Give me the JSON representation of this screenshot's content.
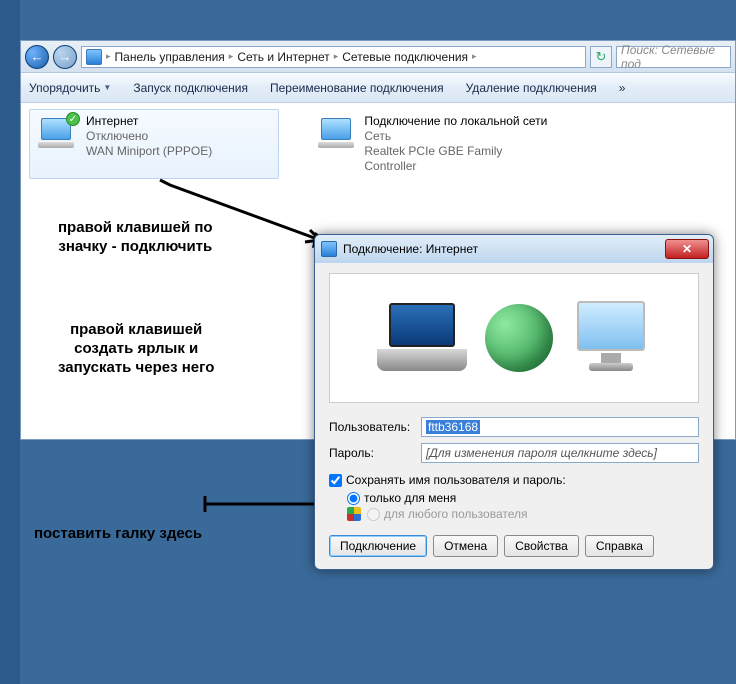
{
  "breadcrumb": {
    "l1": "Панель управления",
    "l2": "Сеть и Интернет",
    "l3": "Сетевые подключения"
  },
  "search_placeholder": "Поиск: Сетевые под",
  "toolbar": {
    "organize": "Упорядочить",
    "start": "Запуск подключения",
    "rename": "Переименование подключения",
    "delete": "Удаление подключения",
    "more": "»"
  },
  "conn1": {
    "name": "Интернет",
    "status": "Отключено",
    "device": "WAN Miniport (PPPOE)"
  },
  "conn2": {
    "name": "Подключение по локальной сети",
    "status": "Сеть",
    "device": "Realtek PCIe GBE Family Controller"
  },
  "annot1": "правой клавишей по\nзначку - подключить",
  "annot2": "правой клавишей\nсоздать ярлык и\nзапускать через него",
  "annot3": "поставить галку здесь",
  "dialog": {
    "title": "Подключение: Интернет",
    "user_label": "Пользователь:",
    "user_value": "fttb36168",
    "pass_label": "Пароль:",
    "pass_value": "[Для изменения пароля щелкните здесь]",
    "save_check": "Сохранять имя пользователя и пароль:",
    "only_me": "только для меня",
    "any_user": "для любого пользователя",
    "btn_connect": "Подключение",
    "btn_cancel": "Отмена",
    "btn_props": "Свойства",
    "btn_help": "Справка"
  }
}
